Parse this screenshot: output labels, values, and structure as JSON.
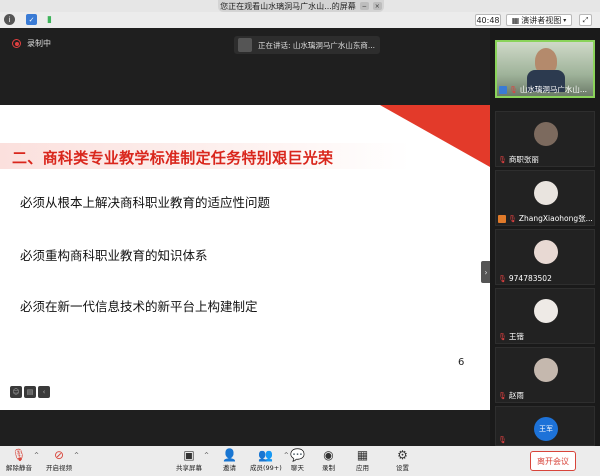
{
  "window": {
    "title": "您正在观看山水璃洞马广水山...的屏幕"
  },
  "topbar": {
    "timer": "40:48",
    "view_label": "演讲者视图",
    "colors": {
      "info": "#555555",
      "shield": "#3a7bd5",
      "signal": "#3db35a"
    }
  },
  "share": {
    "recording_label": "录制中",
    "speaking_label": "正在讲话: 山水璃洞马广水山东商..."
  },
  "slide": {
    "heading": "二、商科类专业教学标准制定任务特别艰巨光荣",
    "lines": [
      "必须从根本上解决商科职业教育的适应性问题",
      "必须重构商科职业教育的知识体系",
      "必须在新一代信息技术的新平台上构建制定"
    ],
    "page_number": "6",
    "accent_color": "#d9261c"
  },
  "gallery": {
    "participants": [
      {
        "name": "山水璃洞马广水山...",
        "active": true
      },
      {
        "name": "商职张丽"
      },
      {
        "name": "ZhangXiaohong张..."
      },
      {
        "name": "974783502"
      },
      {
        "name": "王锴"
      },
      {
        "name": "赵雨"
      },
      {
        "name": "",
        "avatar_text": "王军"
      }
    ]
  },
  "toolbar": {
    "mute_label": "解除静音",
    "video_label": "开启视频",
    "share_label": "共享屏幕",
    "invite_label": "邀请",
    "members_label": "成员(99+)",
    "chat_label": "聊天",
    "record_label": "录制",
    "apps_label": "应用",
    "settings_label": "设置",
    "leave_label": "离开会议"
  }
}
